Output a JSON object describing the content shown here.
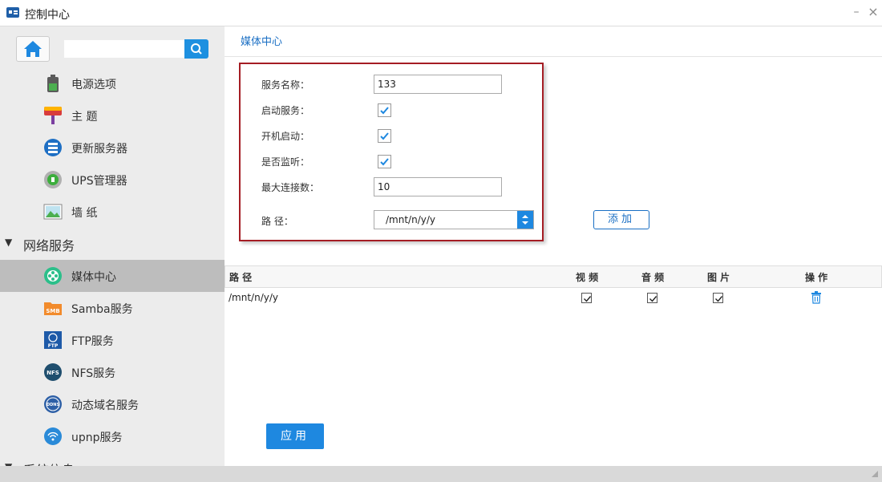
{
  "window": {
    "title": "控制中心",
    "min_label": "–",
    "close_label": "×"
  },
  "sidebar": {
    "search_value": "",
    "items_top": [
      {
        "label": "电源选项",
        "icon": "battery-icon"
      },
      {
        "label": "主 题",
        "icon": "paint-roller-icon"
      },
      {
        "label": "更新服务器",
        "icon": "server-icon"
      },
      {
        "label": "UPS管理器",
        "icon": "ups-icon"
      },
      {
        "label": "墙 纸",
        "icon": "wallpaper-icon"
      }
    ],
    "section_network": {
      "label": "网络服务",
      "arrow": "▼"
    },
    "items_network": [
      {
        "label": "媒体中心",
        "icon": "film-reel-icon"
      },
      {
        "label": "Samba服务",
        "icon": "samba-icon",
        "badge": "SMB"
      },
      {
        "label": "FTP服务",
        "icon": "ftp-icon",
        "badge": "FTP"
      },
      {
        "label": "NFS服务",
        "icon": "nfs-icon",
        "badge": "NFS"
      },
      {
        "label": "动态域名服务",
        "icon": "ddns-icon",
        "badge": "DDNS"
      },
      {
        "label": "upnp服务",
        "icon": "upnp-icon"
      }
    ],
    "section_system": {
      "label": "系统信息",
      "arrow": "▼"
    }
  },
  "main": {
    "title": "媒体中心",
    "form": {
      "service_name_label": "服务名称：",
      "service_name_value": "133",
      "start_service_label": "启动服务：",
      "start_service_checked": true,
      "boot_start_label": "开机启动：",
      "boot_start_checked": true,
      "monitor_label": "是否监听：",
      "monitor_checked": true,
      "max_conn_label": "最大连接数：",
      "max_conn_value": "10",
      "path_label": "路 径：",
      "path_value": "/mnt/n/y/y"
    },
    "add_label": "添加",
    "table": {
      "headers": [
        "路 径",
        "视 频",
        "音 频",
        "图 片",
        "操 作"
      ],
      "rows": [
        {
          "path": "/mnt/n/y/y",
          "video": true,
          "audio": true,
          "image": true,
          "action_icon": "trash-icon"
        }
      ]
    },
    "apply_label": "应用"
  },
  "colors": {
    "accent": "#1e88e0",
    "highlight_border": "#a51d24",
    "active_nav": "#bdbdbd"
  }
}
